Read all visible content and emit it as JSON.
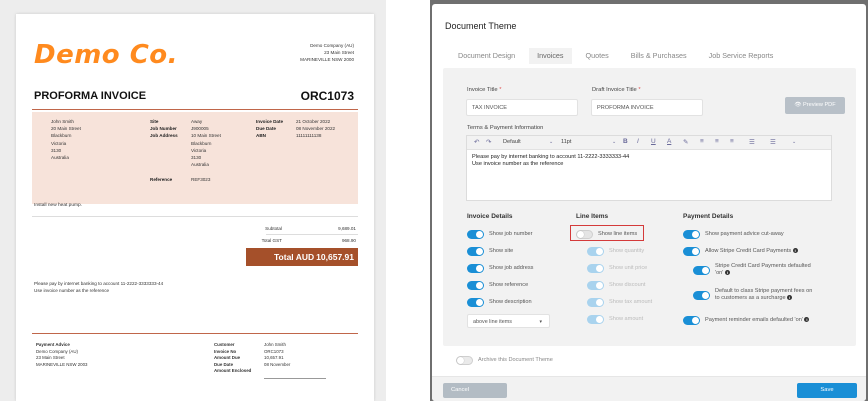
{
  "invoice": {
    "logo": "Demo Co.",
    "from": {
      "company": "Demo Company (AU)",
      "street": "23 Main Street",
      "city": "MARINEVILLE NSW 2000"
    },
    "title": "PROFORMA INVOICE",
    "number": "ORC1073",
    "customer": [
      "John Smith",
      "20 Main Street",
      "Blackburn",
      "Victoria",
      "3130",
      "Australia"
    ],
    "site_labels": {
      "site": "Site",
      "job_number": "Job Number",
      "job_address": "Job Address",
      "reference": "Reference"
    },
    "site_values": {
      "site": "Away",
      "job_number": "J900005",
      "job_address": [
        "10 Main Street",
        "Blackburn",
        "Victoria",
        "3130",
        "Australia"
      ],
      "reference": "REF3023"
    },
    "date_labels": {
      "invoice_date": "Invoice Date",
      "due_date": "Due Date",
      "abn": "ABN"
    },
    "date_values": {
      "invoice_date": "21 October 2022",
      "due_date": "08 November 2022",
      "abn": "11111111138"
    },
    "description": "Install new heat pump.",
    "subtotal_label": "Subtotal",
    "subtotal_value": "9,689.01",
    "gst_label": "Total GST",
    "gst_value": "968.90",
    "total_label": "Total AUD",
    "total_value": "10,657.91",
    "payment_note": [
      "Please pay by internet banking to account 11-2222-3333333-44",
      "Use invoice number as the reference"
    ],
    "advice": {
      "title": "Payment Advice",
      "lines": [
        "Demo Company (AU)",
        "23 Main Street",
        "MARINEVILLE NSW 2003"
      ],
      "labels": [
        "Customer",
        "Invoice No",
        "Amount Due",
        "Due Date",
        "Amount Enclosed"
      ],
      "values": [
        "John Smith",
        "ORC1073",
        "10,657.91",
        "08 November"
      ]
    }
  },
  "modal": {
    "title": "Document Theme",
    "tabs": [
      "Document Design",
      "Invoices",
      "Quotes",
      "Bills & Purchases",
      "Job Service Reports"
    ],
    "invoice_title_label": "Invoice Title",
    "invoice_title_value": "TAX INVOICE",
    "draft_title_label": "Draft Invoice Title",
    "draft_title_value": "PROFORMA INVOICE",
    "required_mark": "*",
    "preview_button": "👁 Preview PDF",
    "terms_label": "Terms & Payment Information",
    "toolbar": {
      "undo": "↶",
      "redo": "↷",
      "font": "Default",
      "size": "11pt",
      "bold": "B",
      "italic": "I",
      "underline": "U",
      "text_color": "A",
      "highlight": "✎",
      "align_left": "≡",
      "align_center": "≡",
      "align_right": "≡",
      "bullets": "☰",
      "numbers": "☰",
      "caret": "⌄"
    },
    "terms_text": [
      "Please pay by internet banking to account 11-2222-3333333-44",
      "Use invoice number as the reference"
    ],
    "invoice_details_head": "Invoice Details",
    "line_items_head": "Line Items",
    "payment_details_head": "Payment Details",
    "invoice_details": [
      {
        "label": "Show job number",
        "on": true
      },
      {
        "label": "Show site",
        "on": true
      },
      {
        "label": "Show job address",
        "on": true
      },
      {
        "label": "Show reference",
        "on": true
      },
      {
        "label": "Show description",
        "on": true
      }
    ],
    "line_items": [
      {
        "label": "Show line items",
        "on": false
      },
      {
        "label": "Show quantity",
        "on": true
      },
      {
        "label": "Show unit price",
        "on": true
      },
      {
        "label": "Show discount",
        "on": true
      },
      {
        "label": "Show tax amount",
        "on": true
      },
      {
        "label": "Show amount",
        "on": true
      }
    ],
    "payment_details": {
      "advice": "Show payment advice cut-away",
      "stripe": "Allow Stripe Credit Card Payments",
      "stripe_default_1": "Stripe Credit Card Payments defaulted",
      "stripe_default_2": "'on'",
      "surcharge_1": "Default to class Stripe payment fees on",
      "surcharge_2": "to customers as a surcharge",
      "reminder": "Payment reminder emails defaulted 'on'"
    },
    "description_position": "above line items",
    "archive_label": "Archive this Document Theme",
    "cancel_label": "Cancel",
    "save_label": "Save",
    "colors": {
      "accent": "#1a8fd6",
      "highlight_box": "#d43a3a",
      "invoice_band": "#a5502a",
      "logo": "#ff8a1e"
    }
  }
}
